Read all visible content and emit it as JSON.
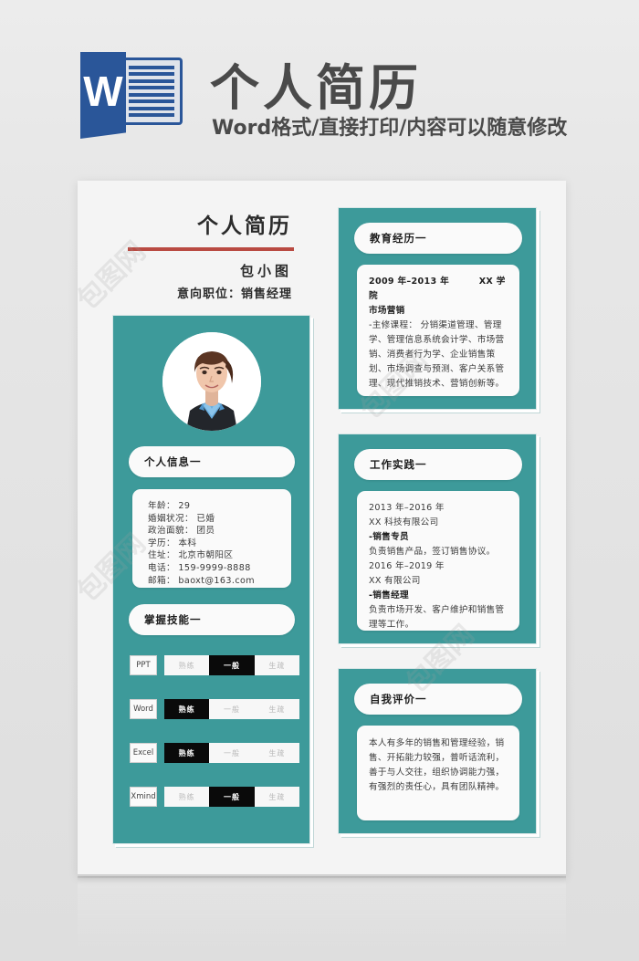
{
  "promo": {
    "logo_letter": "W",
    "title": "个人简历",
    "subtitle": "Word格式/直接打印/内容可以随意修改"
  },
  "resume": {
    "title": "个人简历",
    "name": "包小图",
    "position_label": "意向职位：销售经理",
    "photo_alt": "求职者证件照",
    "personal_info": {
      "heading": "个人信息一",
      "rows": [
        "年龄： 29",
        "婚姻状况： 已婚",
        "政治面貌： 团员",
        "学历： 本科",
        "住址： 北京市朝阳区",
        "电话： 159-9999-8888",
        "邮箱： baoxt@163.com"
      ]
    },
    "skills": {
      "heading": "掌握技能一",
      "levels": [
        "熟练",
        "一般",
        "生疏"
      ],
      "items": [
        {
          "name": "PPT",
          "level": "一般"
        },
        {
          "name": "Word",
          "level": "熟练"
        },
        {
          "name": "Excel",
          "level": "熟练"
        },
        {
          "name": "Xmind",
          "level": "一般"
        }
      ]
    },
    "education": {
      "heading": "教育经历一",
      "period": "2009 年–2013 年",
      "school": "XX 学院",
      "major": "市场营销",
      "courses": "-主修课程： 分销渠道管理、管理学、管理信息系统会计学、市场营销、消费者行为学、企业销售策划、市场调查与预测、客户关系管理、现代推销技术、营销创新等。"
    },
    "work": {
      "heading": "工作实践一",
      "entries": [
        {
          "period": "2013 年–2016 年",
          "company": "XX 科技有限公司",
          "role": "-销售专员",
          "desc": "负责销售产品，签订销售协议。"
        },
        {
          "period": "2016 年–2019 年",
          "company": "XX 有限公司",
          "role": "-销售经理",
          "desc": "负责市场开发、客户维护和销售管理等工作。"
        }
      ]
    },
    "self_evaluation": {
      "heading": "自我评价一",
      "text": "本人有多年的销售和管理经验，销售、开拓能力较强，普听话流利，善于与人交往，组织协调能力强，有强烈的责任心，具有团队精神。"
    }
  },
  "theme": {
    "teal": "#3d9a9a",
    "accent_red": "#b94a42",
    "card_bg": "#fafafa",
    "page_bg": "#f4f4f4",
    "word_blue": "#2a5699"
  },
  "watermark": {
    "text": "包图网"
  }
}
